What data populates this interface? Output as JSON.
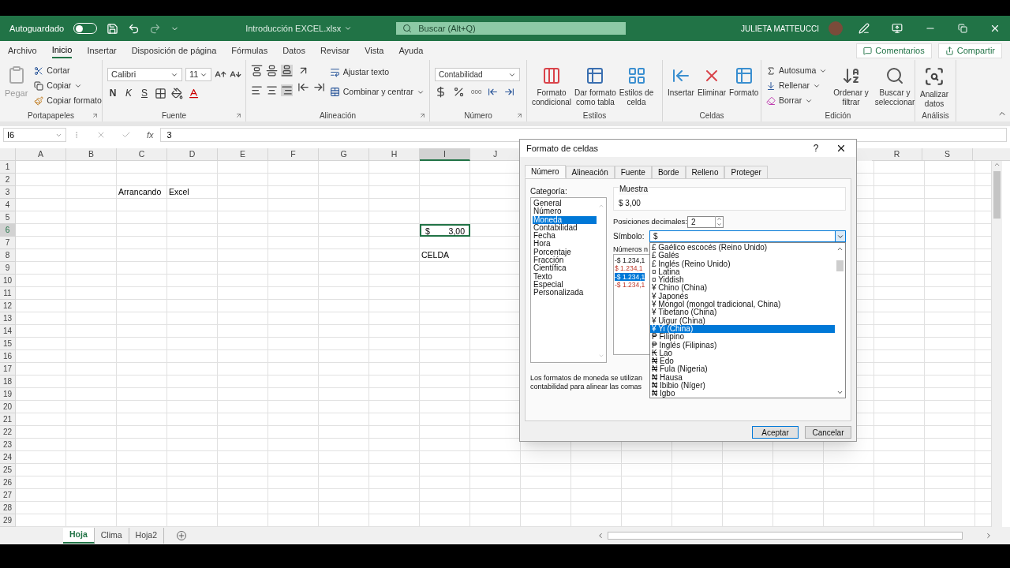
{
  "title_bar": {
    "autosave_label": "Autoguardado",
    "autosave_on": false,
    "document_title": "Introducción EXCEL.xlsx",
    "search_placeholder": "Buscar (Alt+Q)",
    "user_name": "JULIETA MATTEUCCI"
  },
  "ribbon_tabs": [
    {
      "label": "Archivo",
      "selected": false
    },
    {
      "label": "Inicio",
      "selected": true
    },
    {
      "label": "Insertar",
      "selected": false
    },
    {
      "label": "Disposición de página",
      "selected": false
    },
    {
      "label": "Fórmulas",
      "selected": false
    },
    {
      "label": "Datos",
      "selected": false
    },
    {
      "label": "Revisar",
      "selected": false
    },
    {
      "label": "Vista",
      "selected": false
    },
    {
      "label": "Ayuda",
      "selected": false
    }
  ],
  "ribbon_actions": [
    "Comentarios",
    "Compartir"
  ],
  "clipboard": {
    "label": "Portapapeles",
    "paste": "Pegar",
    "cut": "Cortar",
    "copy": "Copiar",
    "format_painter": "Copiar formato"
  },
  "font": {
    "label": "Fuente",
    "name": "Calibri",
    "size": "11",
    "bold": "N",
    "italic": "K",
    "underline": "S"
  },
  "alignment": {
    "label": "Alineación",
    "wrap": "Ajustar texto",
    "merge": "Combinar y centrar"
  },
  "number": {
    "label": "Número",
    "format": "Contabilidad",
    "thousands": "000"
  },
  "styles": {
    "label": "Estilos",
    "buttons": [
      "Formato\ncondicional",
      "Dar formato\ncomo tabla",
      "Estilos de\ncelda"
    ]
  },
  "cells_group": {
    "label": "Celdas",
    "buttons": [
      "Insertar",
      "Eliminar",
      "Formato"
    ]
  },
  "editing": {
    "label": "Edición",
    "autosum": "Autosuma",
    "fill": "Rellenar",
    "clear": "Borrar",
    "sort": "Ordenar y\nfiltrar",
    "find": "Buscar y\nseleccionar"
  },
  "analysis": {
    "label": "Análisis",
    "button": "Analizar\ndatos"
  },
  "formula_bar": {
    "name_box": "I6",
    "function_button": "fx",
    "formula": "3"
  },
  "columns": [
    {
      "label": "A",
      "selected": false
    },
    {
      "label": "B",
      "selected": false
    },
    {
      "label": "C",
      "selected": false
    },
    {
      "label": "D",
      "selected": false
    },
    {
      "label": "E",
      "selected": false
    },
    {
      "label": "F",
      "selected": false
    },
    {
      "label": "G",
      "selected": false
    },
    {
      "label": "H",
      "selected": false
    },
    {
      "label": "I",
      "selected": true
    },
    {
      "label": "J",
      "selected": false
    }
  ],
  "right_columns": [
    {
      "label": "R",
      "selected": false
    },
    {
      "label": "S",
      "selected": false
    }
  ],
  "rows": [
    {
      "label": "1",
      "selected": false
    },
    {
      "label": "2",
      "selected": false
    },
    {
      "label": "3",
      "selected": false,
      "cells": [
        null,
        null,
        "Arrancando",
        "Excel"
      ]
    },
    {
      "label": "4",
      "selected": false
    },
    {
      "label": "5",
      "selected": false
    },
    {
      "label": "6",
      "selected": true,
      "cells": [
        null,
        null,
        null,
        null,
        null,
        null,
        null,
        null,
        {
          "symbol": "$",
          "value": "3,00",
          "selected": true
        }
      ]
    },
    {
      "label": "7",
      "selected": false
    },
    {
      "label": "8",
      "selected": false,
      "cells": [
        null,
        null,
        null,
        null,
        null,
        null,
        null,
        null,
        "CELDA"
      ]
    },
    {
      "label": "9",
      "selected": false
    },
    {
      "label": "10",
      "selected": false
    },
    {
      "label": "11",
      "selected": false
    },
    {
      "label": "12",
      "selected": false
    },
    {
      "label": "13",
      "selected": false
    },
    {
      "label": "14",
      "selected": false
    },
    {
      "label": "15",
      "selected": false
    },
    {
      "label": "16",
      "selected": false
    },
    {
      "label": "17",
      "selected": false
    },
    {
      "label": "18",
      "selected": false
    },
    {
      "label": "19",
      "selected": false
    },
    {
      "label": "20",
      "selected": false
    },
    {
      "label": "21",
      "selected": false
    },
    {
      "label": "22",
      "selected": false
    },
    {
      "label": "23",
      "selected": false
    },
    {
      "label": "24",
      "selected": false
    },
    {
      "label": "25",
      "selected": false
    },
    {
      "label": "26",
      "selected": false
    },
    {
      "label": "27",
      "selected": false
    },
    {
      "label": "28",
      "selected": false
    },
    {
      "label": "29",
      "selected": false
    }
  ],
  "sheet_tabs": [
    {
      "label": "Hoja",
      "selected": true
    },
    {
      "label": "Clima",
      "selected": false
    },
    {
      "label": "Hoja2",
      "selected": false
    }
  ],
  "dialog": {
    "title": "Formato de celdas",
    "help": "?",
    "tabs": [
      {
        "label": "Número",
        "selected": true
      },
      {
        "label": "Alineación",
        "selected": false
      },
      {
        "label": "Fuente",
        "selected": false
      },
      {
        "label": "Borde",
        "selected": false
      },
      {
        "label": "Relleno",
        "selected": false
      },
      {
        "label": "Proteger",
        "selected": false
      }
    ],
    "category_label": "Categoría:",
    "categories": [
      {
        "label": "General",
        "selected": false
      },
      {
        "label": "Número",
        "selected": false
      },
      {
        "label": "Moneda",
        "selected": true
      },
      {
        "label": "Contabilidad",
        "selected": false
      },
      {
        "label": "Fecha",
        "selected": false
      },
      {
        "label": "Hora",
        "selected": false
      },
      {
        "label": "Porcentaje",
        "selected": false
      },
      {
        "label": "Fracción",
        "selected": false
      },
      {
        "label": "Científica",
        "selected": false
      },
      {
        "label": "Texto",
        "selected": false
      },
      {
        "label": "Especial",
        "selected": false
      },
      {
        "label": "Personalizada",
        "selected": false
      }
    ],
    "sample_label": "Muestra",
    "sample": "$ 3,00",
    "decimals_label": "Posiciones decimales:",
    "decimals": "2",
    "symbol_label": "Símbolo:",
    "symbol": "$",
    "symbol_options": [
      {
        "label": "£ Gaélico escocés (Reino Unido)",
        "selected": false
      },
      {
        "label": "£ Galés",
        "selected": false
      },
      {
        "label": "£ Inglés (Reino Unido)",
        "selected": false
      },
      {
        "label": "¤ Latina",
        "selected": false
      },
      {
        "label": "¤ Yiddish",
        "selected": false
      },
      {
        "label": "¥ Chino (China)",
        "selected": false
      },
      {
        "label": "¥ Japonés",
        "selected": false
      },
      {
        "label": "¥ Mongol (mongol tradicional, China)",
        "selected": false
      },
      {
        "label": "¥ Tibetano (China)",
        "selected": false
      },
      {
        "label": "¥ Uigur (China)",
        "selected": false
      },
      {
        "label": "¥ Yi (China)",
        "selected": true
      },
      {
        "label": "₱ Filipino",
        "selected": false
      },
      {
        "label": "₱ Inglés (Filipinas)",
        "selected": false
      },
      {
        "label": "₭ Lao",
        "selected": false
      },
      {
        "label": "₦ Edo",
        "selected": false
      },
      {
        "label": "₦ Fula (Nigeria)",
        "selected": false
      },
      {
        "label": "₦ Hausa",
        "selected": false
      },
      {
        "label": "₦ Ibibio (Níger)",
        "selected": false
      },
      {
        "label": "₦ Igbo",
        "selected": false
      }
    ],
    "negatives_label": "Números n",
    "negatives": [
      {
        "text": "-$ 1.234,1",
        "red": false,
        "selected": false
      },
      {
        "text": "$ 1.234,1",
        "red": true,
        "selected": false
      },
      {
        "text": "-$ 1.234,1",
        "red": false,
        "selected": true
      },
      {
        "text": "-$ 1.234,1",
        "red": true,
        "selected": false
      }
    ],
    "description_lines": [
      "Los formatos de moneda se utilizan",
      "contabilidad para alinear las comas"
    ],
    "ok": "Aceptar",
    "cancel": "Cancelar"
  }
}
